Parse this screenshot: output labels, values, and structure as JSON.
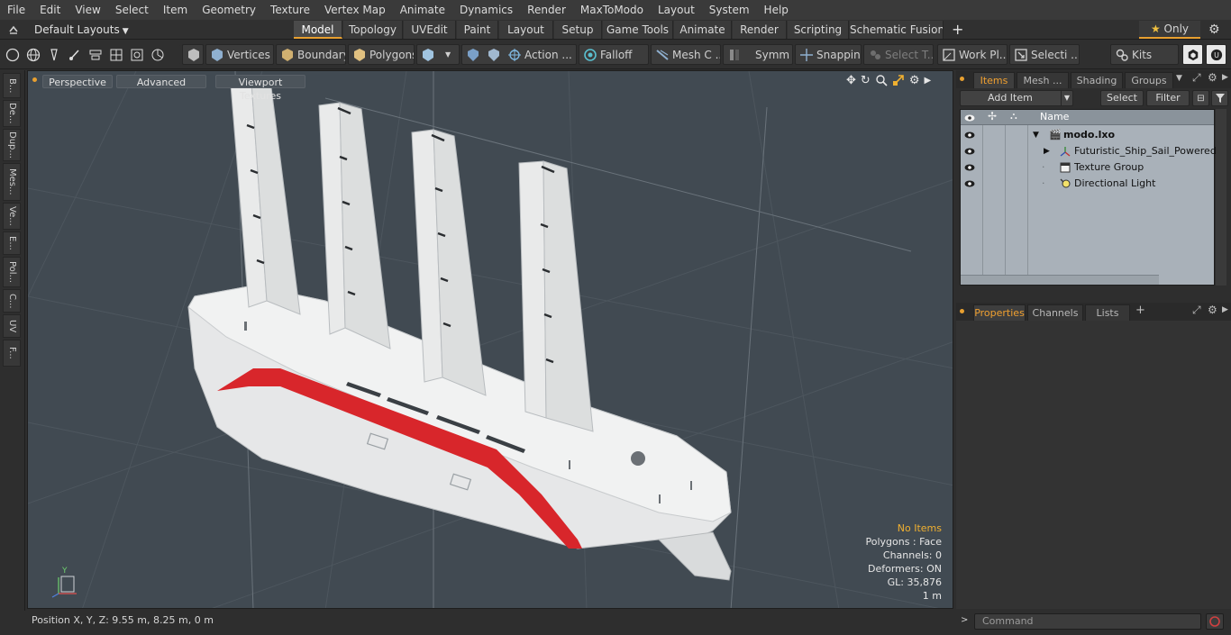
{
  "menubar": {
    "items": [
      "File",
      "Edit",
      "View",
      "Select",
      "Item",
      "Geometry",
      "Texture",
      "Vertex Map",
      "Animate",
      "Dynamics",
      "Render",
      "MaxToModo",
      "Layout",
      "System",
      "Help"
    ]
  },
  "layoutbar": {
    "layout_selector": "Default Layouts",
    "tabs": [
      "Model",
      "Topology",
      "UVEdit",
      "Paint",
      "Layout",
      "Setup",
      "Game Tools",
      "Animate",
      "Render",
      "Scripting",
      "Schematic Fusion"
    ],
    "active_tab": "Model",
    "only_label": "Only"
  },
  "toolbar": {
    "vertices": "Vertices",
    "boundary": "Boundary",
    "polygons": "Polygons",
    "action": "Action ...",
    "falloff": "Falloff",
    "mesh_c": "Mesh C ...",
    "symm": "Symm ...",
    "snapping": "Snapping",
    "select_t": "Select T...",
    "work_pl": "Work Pl...",
    "selecti": "Selecti ...",
    "kits": "Kits"
  },
  "leftstrip": {
    "tabs": [
      "B...",
      "De...",
      "Dup...",
      "Mes...",
      "Ve...",
      "E...",
      "Pol...",
      "C...",
      "UV",
      "F..."
    ]
  },
  "viewport": {
    "tabs": [
      "Perspective",
      "Advanced",
      "Viewport Textures"
    ],
    "stats": {
      "selection": "No Items",
      "polygons": "Polygons : Face",
      "channels": "Channels: 0",
      "deformers": "Deformers: ON",
      "gl": "GL: 35,876",
      "scale": "1 m"
    },
    "axis_y": "Y"
  },
  "statusbar": {
    "position": "Position X, Y, Z:   9.55 m, 8.25 m, 0 m"
  },
  "items_panel": {
    "tabs": [
      "Items",
      "Mesh ...",
      "Shading",
      "Groups"
    ],
    "active_tab": "Items",
    "add_item": "Add Item",
    "select": "Select",
    "filter": "Filter",
    "column_name": "Name",
    "tree": [
      {
        "label": "modo.lxo",
        "indent": 0
      },
      {
        "label": "Futuristic_Ship_Sail_Powered",
        "indent": 1
      },
      {
        "label": "Texture Group",
        "indent": 1
      },
      {
        "label": "Directional Light",
        "indent": 1
      }
    ]
  },
  "properties_panel": {
    "tabs": [
      "Properties",
      "Channels",
      "Lists"
    ],
    "active_tab": "Properties"
  },
  "command": {
    "placeholder": "Command"
  }
}
